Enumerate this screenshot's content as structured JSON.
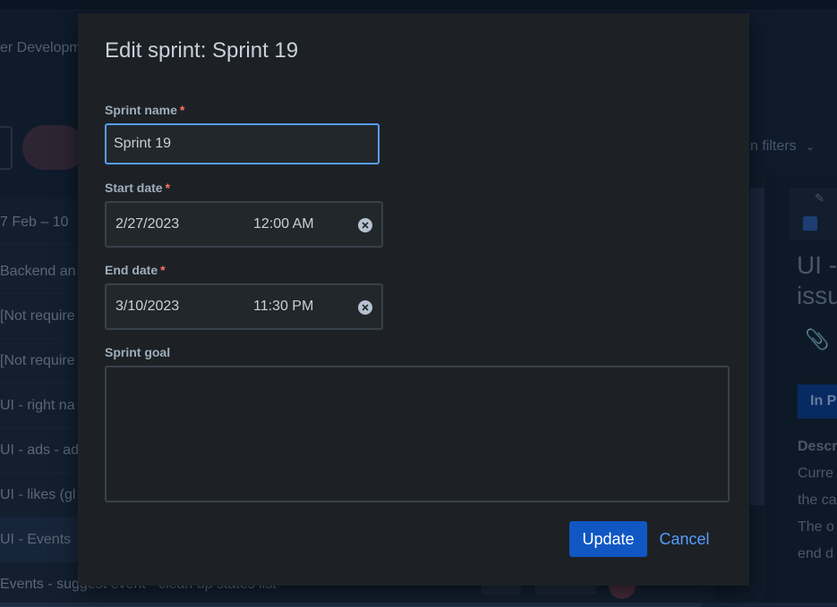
{
  "background": {
    "breadcrumb": "er Developm",
    "filters_label": "n filters",
    "sprint_dates": "7 Feb – 10",
    "rows": [
      "Backend an",
      "[Not require",
      "[Not require",
      "UI - right na",
      "UI - ads - ad",
      "UI - likes (gl",
      "UI - Events",
      "Events - suggest event - clean up states list"
    ],
    "detail": {
      "title": "UI -\nissu",
      "status": "In P",
      "description_label": "Descr",
      "description_lines": [
        "Curre",
        "the ca",
        "The o",
        "end d"
      ]
    }
  },
  "modal": {
    "title": "Edit sprint: Sprint 19",
    "sprint_name": {
      "label": "Sprint name",
      "required": "*",
      "value": "Sprint 19"
    },
    "start_date": {
      "label": "Start date",
      "required": "*",
      "date": "2/27/2023",
      "time": "12:00 AM"
    },
    "end_date": {
      "label": "End date",
      "required": "*",
      "date": "3/10/2023",
      "time": "11:30 PM"
    },
    "sprint_goal": {
      "label": "Sprint goal",
      "value": ""
    },
    "update_label": "Update",
    "cancel_label": "Cancel"
  },
  "colors": {
    "accent": "#579dff",
    "primary_button": "#1057c4",
    "required": "#f87462",
    "modal_bg": "#1d2125"
  },
  "icons": [
    "clear-icon",
    "chevron-down-icon",
    "paperclip-icon",
    "pencil-icon",
    "checkbox-icon"
  ]
}
